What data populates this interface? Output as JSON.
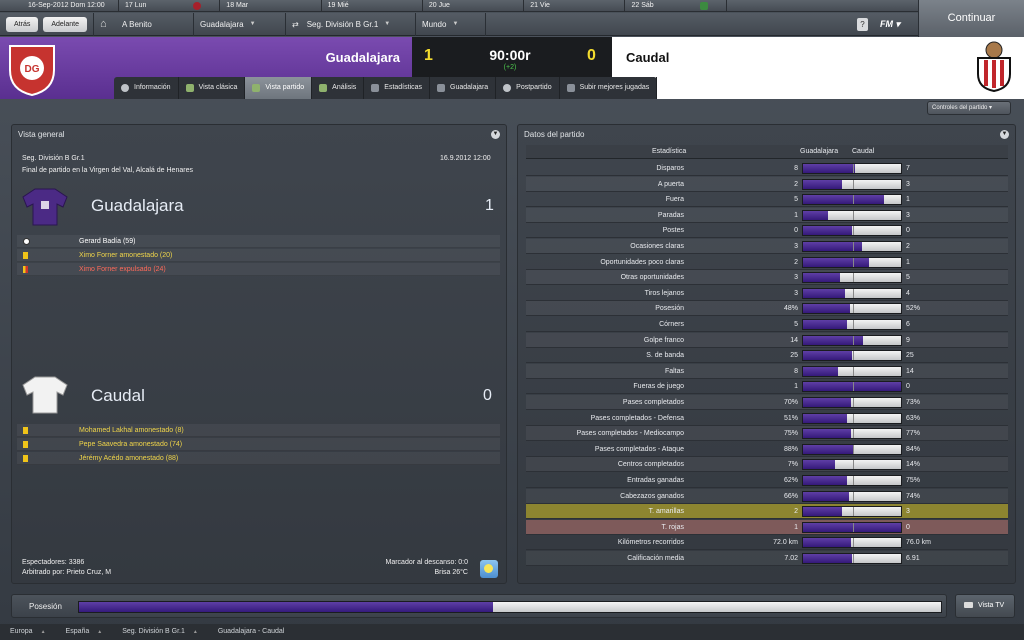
{
  "topbar": {
    "current_date": "16-Sep-2012 Dom 12:00",
    "days": [
      "17 Lun",
      "18 Mar",
      "19 Mié",
      "20 Jue",
      "21 Vie",
      "22 Sáb"
    ],
    "continue_label": "Continuar"
  },
  "nav": {
    "back_label": "Atrás",
    "forward_label": "Adelante",
    "manager": "A Benito",
    "team": "Guadalajara",
    "competition": "Seg. División B Gr.1",
    "world": "Mundo",
    "help": "?",
    "fm": "FM"
  },
  "match": {
    "home_team": "Guadalajara",
    "away_team": "Caudal",
    "home_score": "1",
    "away_score": "0",
    "clock": "90:00r",
    "added_time": "(+2)",
    "accent_home": "#6a3ca0",
    "accent_score": "#f3dc2e"
  },
  "tabs": [
    "Información",
    "Vista clásica",
    "Vista partido",
    "Análisis",
    "Estadísticas",
    "Guadalajara",
    "Postpartido",
    "Subir mejores jugadas"
  ],
  "controls_label": "Controles del partido",
  "overview": {
    "title": "Vista general",
    "competition": "Seg. División B Gr.1",
    "datetime": "16.9.2012 12:00",
    "venue": "Final de partido en la Virgen del Val, Alcalá de Henares",
    "home_team": "Guadalajara",
    "home_score": "1",
    "away_team": "Caudal",
    "away_score": "0",
    "home_events": [
      {
        "text": "Gerard Badía (59)",
        "type": "goal"
      },
      {
        "text": "Ximo Forner amonestado (20)",
        "type": "yellow"
      },
      {
        "text": "Ximo Forner expulsado (24)",
        "type": "red"
      }
    ],
    "away_events": [
      {
        "text": "Mohamed Lakhal amonestado (8)",
        "type": "yellow"
      },
      {
        "text": "Pepe Saavedra amonestado (74)",
        "type": "yellow"
      },
      {
        "text": "Jérémy Acédo amonestado (88)",
        "type": "yellow"
      }
    ],
    "spectators": "Espectadores: 3386",
    "referee": "Arbitrado por: Prieto Cruz, M",
    "halftime": "Marcador al descanso: 0:0",
    "weather": "Brisa 26°C"
  },
  "stats": {
    "title": "Datos del partido",
    "col_stat": "Estadística",
    "col_home": "Guadalajara",
    "col_away": "Caudal",
    "rows": [
      {
        "name": "Disparos",
        "home": "8",
        "away": "7",
        "share": 0.53
      },
      {
        "name": "A puerta",
        "home": "2",
        "away": "3",
        "share": 0.4
      },
      {
        "name": "Fuera",
        "home": "5",
        "away": "1",
        "share": 0.83
      },
      {
        "name": "Paradas",
        "home": "1",
        "away": "3",
        "share": 0.25
      },
      {
        "name": "Postes",
        "home": "0",
        "away": "0",
        "share": 0.5
      },
      {
        "name": "Ocasiones claras",
        "home": "3",
        "away": "2",
        "share": 0.6
      },
      {
        "name": "Oportunidades poco claras",
        "home": "2",
        "away": "1",
        "share": 0.67
      },
      {
        "name": "Otras oportunidades",
        "home": "3",
        "away": "5",
        "share": 0.38
      },
      {
        "name": "Tiros lejanos",
        "home": "3",
        "away": "4",
        "share": 0.43
      },
      {
        "name": "Posesión",
        "home": "48%",
        "away": "52%",
        "share": 0.48
      },
      {
        "name": "Córners",
        "home": "5",
        "away": "6",
        "share": 0.45
      },
      {
        "name": "Golpe franco",
        "home": "14",
        "away": "9",
        "share": 0.61
      },
      {
        "name": "S. de banda",
        "home": "25",
        "away": "25",
        "share": 0.5
      },
      {
        "name": "Faltas",
        "home": "8",
        "away": "14",
        "share": 0.36
      },
      {
        "name": "Fueras de juego",
        "home": "1",
        "away": "0",
        "share": 1.0
      },
      {
        "name": "Pases completados",
        "home": "70%",
        "away": "73%",
        "share": 0.49
      },
      {
        "name": "Pases completados - Defensa",
        "home": "51%",
        "away": "63%",
        "share": 0.45
      },
      {
        "name": "Pases completados - Mediocampo",
        "home": "75%",
        "away": "77%",
        "share": 0.49
      },
      {
        "name": "Pases completados - Ataque",
        "home": "88%",
        "away": "84%",
        "share": 0.51
      },
      {
        "name": "Centros completados",
        "home": "7%",
        "away": "14%",
        "share": 0.33
      },
      {
        "name": "Entradas ganadas",
        "home": "62%",
        "away": "75%",
        "share": 0.45
      },
      {
        "name": "Cabezazos ganados",
        "home": "66%",
        "away": "74%",
        "share": 0.47
      },
      {
        "name": "T. amarillas",
        "home": "2",
        "away": "3",
        "share": 0.4,
        "highlight": "yel"
      },
      {
        "name": "T. rojas",
        "home": "1",
        "away": "0",
        "share": 1.0,
        "highlight": "red"
      },
      {
        "name": "Kilómetros recorridos",
        "home": "72.0 km",
        "away": "76.0 km",
        "share": 0.49
      },
      {
        "name": "Calificación media",
        "home": "7.02",
        "away": "6.91",
        "share": 0.5
      }
    ]
  },
  "possession": {
    "label": "Posesión",
    "home_share": 0.48
  },
  "vista_tv": "Vista TV",
  "footer": [
    "Europa",
    "España",
    "Seg. División B Gr.1",
    "Guadalajara - Caudal"
  ]
}
